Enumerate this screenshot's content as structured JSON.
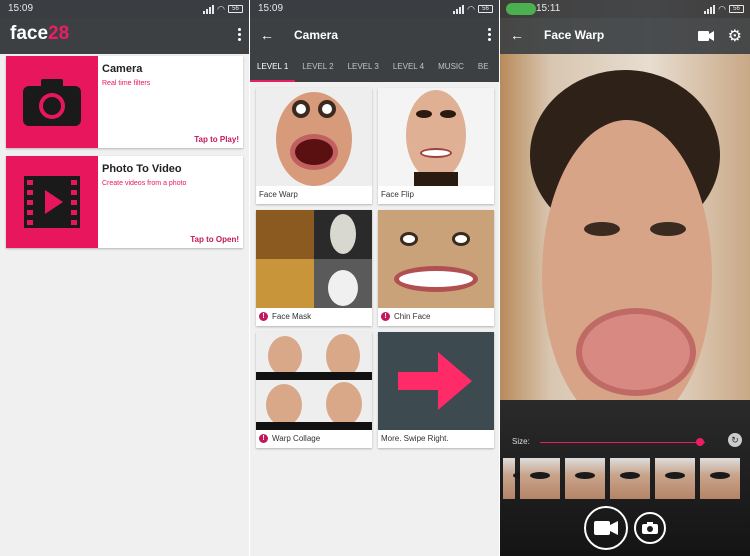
{
  "panel1": {
    "status_time": "15:09",
    "battery": "56",
    "logo_text": "face",
    "logo_suffix": "28",
    "cards": [
      {
        "title": "Camera",
        "subtitle": "Real time filters",
        "action": "Tap to Play!",
        "icon": "camera-icon"
      },
      {
        "title": "Photo To Video",
        "subtitle": "Create videos from a photo",
        "action": "Tap to Open!",
        "icon": "film-play-icon"
      }
    ]
  },
  "panel2": {
    "status_time": "15:09",
    "battery": "56",
    "title": "Camera",
    "tabs": [
      "LEVEL 1",
      "LEVEL 2",
      "LEVEL 3",
      "LEVEL 4",
      "MUSIC",
      "BE"
    ],
    "tiles": [
      {
        "caption": "Face Warp",
        "locked": false
      },
      {
        "caption": "Face Flip",
        "locked": false
      },
      {
        "caption": "Face Mask",
        "locked": true
      },
      {
        "caption": "Chin Face",
        "locked": true
      },
      {
        "caption": "Warp Collage",
        "locked": true
      },
      {
        "caption": "More. Swipe Right.",
        "locked": false
      }
    ]
  },
  "panel3": {
    "status_time": "15:11",
    "battery": "56",
    "title": "Face Warp",
    "size_label": "Size:",
    "size_value": 0.97
  },
  "colors": {
    "accent": "#e91e63",
    "appbar": "#3c4043",
    "status": "#3a3e42"
  }
}
